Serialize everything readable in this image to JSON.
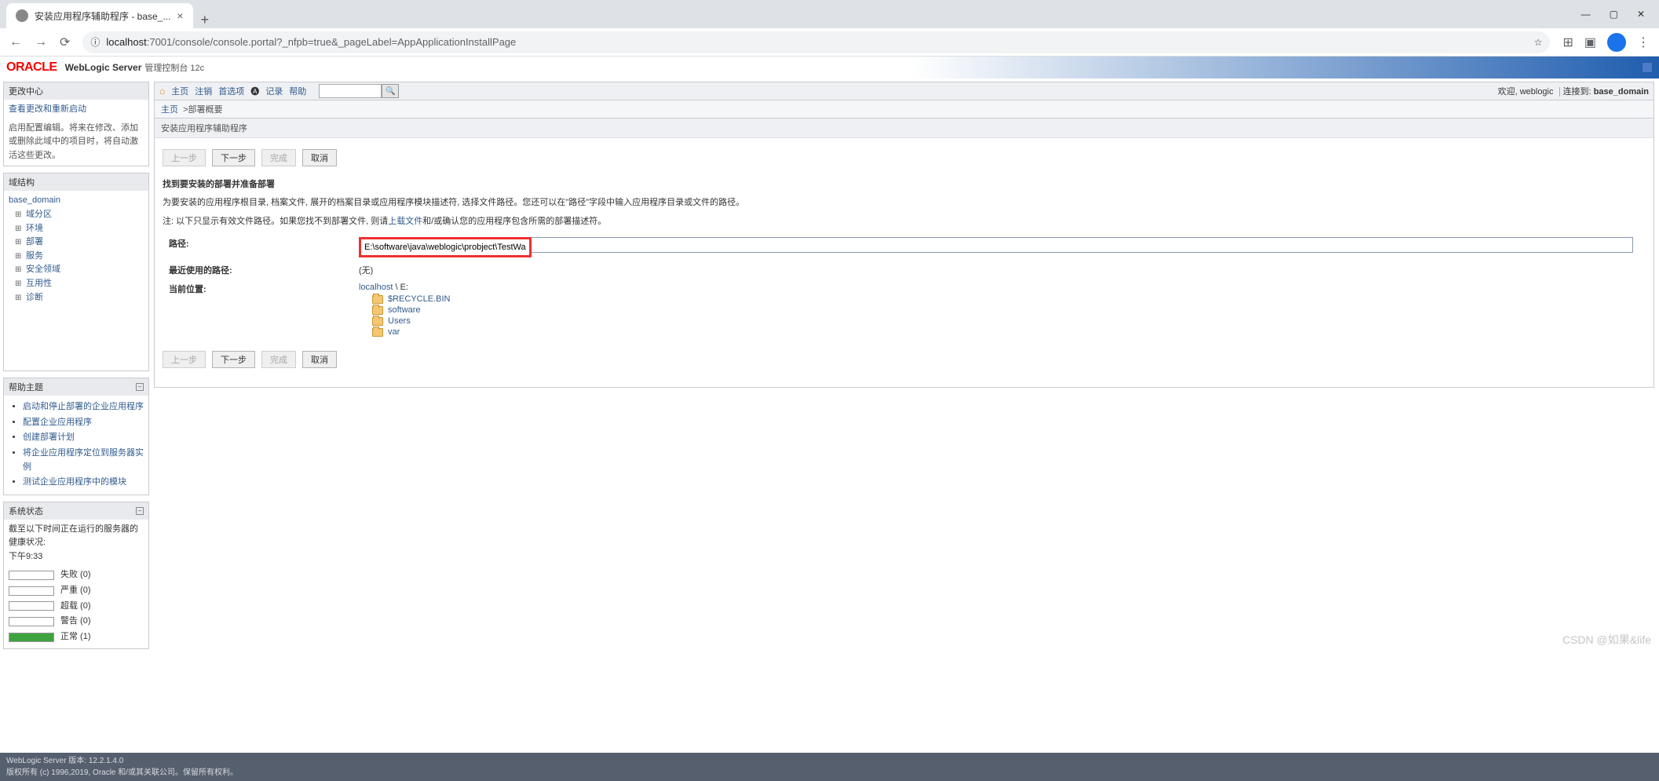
{
  "browser": {
    "tab_title": "安装应用程序辅助程序 - base_...",
    "url_display": "localhost:7001/console/console.portal?_nfpb=true&_pageLabel=AppApplicationInstallPage",
    "url_host": "localhost"
  },
  "header": {
    "logo": "ORACLE",
    "product": "WebLogic Server",
    "console": "管理控制台 12c"
  },
  "left": {
    "change_center": {
      "title": "更改中心",
      "view_changes": "查看更改和重新启动",
      "note": "启用配置编辑。将来在修改、添加或删除此域中的项目时，将自动激活这些更改。"
    },
    "domain_structure": {
      "title": "域结构",
      "root": "base_domain",
      "children": [
        "域分区",
        "环境",
        "部署",
        "服务",
        "安全领域",
        "互用性",
        "诊断"
      ]
    },
    "help": {
      "title": "帮助主题",
      "items": [
        "启动和停止部署的企业应用程序",
        "配置企业应用程序",
        "创建部署计划",
        "将企业应用程序定位到服务器实例",
        "测试企业应用程序中的模块"
      ]
    },
    "system_status": {
      "title": "系统状态",
      "subtitle": "截至以下时间正在运行的服务器的健康状况:",
      "timestamp": "下午9:33",
      "rows": [
        {
          "label": "失败 (0)",
          "cls": ""
        },
        {
          "label": "严重 (0)",
          "cls": ""
        },
        {
          "label": "超载 (0)",
          "cls": ""
        },
        {
          "label": "警告 (0)",
          "cls": ""
        },
        {
          "label": "正常 (1)",
          "cls": "status-green"
        }
      ]
    }
  },
  "toolbar": {
    "home": "主页",
    "logout": "注销",
    "prefs": "首选项",
    "record": "记录",
    "help": "帮助",
    "welcome": "欢迎, weblogic",
    "connected_label": "连接到:",
    "connected_value": "base_domain"
  },
  "breadcrumb": {
    "home": "主页",
    "current": "部署概要"
  },
  "content": {
    "panel_title": "安装应用程序辅助程序",
    "btn_back": "上一步",
    "btn_next": "下一步",
    "btn_finish": "完成",
    "btn_cancel": "取消",
    "section_heading": "找到要安装的部署并准备部署",
    "instruction1": "为要安装的应用程序根目录, 档案文件, 展开的档案目录或应用程序模块描述符, 选择文件路径。您还可以在\"路径\"字段中输入应用程序目录或文件的路径。",
    "note_prefix": "注: 以下只显示有效文件路径。如果您找不到部署文件, 则请",
    "note_link": "上载文件",
    "note_suffix": "和/或确认您的应用程序包含所需的部署描述符。",
    "form": {
      "path_label": "路径:",
      "path_value": "E:\\software\\java\\weblogic\\probject\\TestWas",
      "recent_label": "最近使用的路径:",
      "recent_value": "(无)",
      "current_label": "当前位置:",
      "current_link": "localhost",
      "current_sep": " \\ E:"
    },
    "files": [
      "$RECYCLE.BIN",
      "software",
      "Users",
      "var"
    ]
  },
  "footer": {
    "line1": "WebLogic Server 版本: 12.2.1.4.0",
    "line2": "版权所有 (c) 1996,2019, Oracle 和/或其关联公司。保留所有权利。"
  },
  "watermark": "CSDN @如果&life"
}
